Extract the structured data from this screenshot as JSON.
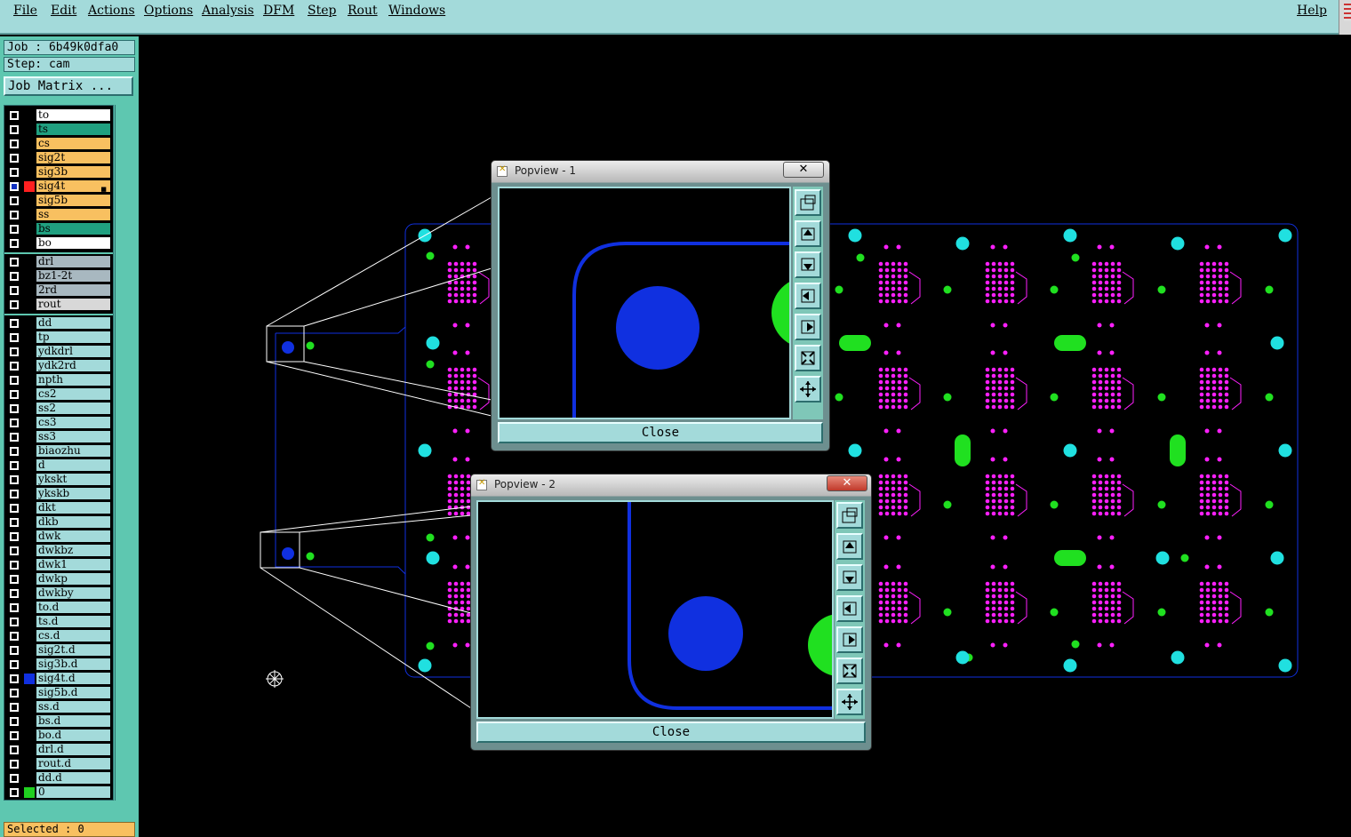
{
  "menu": {
    "file": "File",
    "edit": "Edit",
    "actions": "Actions",
    "options": "Options",
    "analysis": "Analysis",
    "dfm": "DFM",
    "step": "Step",
    "rout": "Rout",
    "windows": "Windows",
    "help": "Help"
  },
  "job": {
    "job_label": "Job : 6b49k0dfa0",
    "step_label": "Step: cam",
    "matrix_button": "Job Matrix ..."
  },
  "status": {
    "selected": "Selected : 0"
  },
  "layers": [
    {
      "name": "to",
      "bg": "#ffffff"
    },
    {
      "name": "ts",
      "bg": "#20a080"
    },
    {
      "name": "cs",
      "bg": "#f8c060"
    },
    {
      "name": "sig2t",
      "bg": "#f8c060"
    },
    {
      "name": "sig3b",
      "bg": "#f8c060"
    },
    {
      "name": "sig4t",
      "bg": "#f8c060",
      "selected": true,
      "color": "#ff2020"
    },
    {
      "name": "sig5b",
      "bg": "#f8c060"
    },
    {
      "name": "ss",
      "bg": "#f8c060"
    },
    {
      "name": "bs",
      "bg": "#20a080"
    },
    {
      "name": "bo",
      "bg": "#ffffff"
    },
    {
      "name": "drl",
      "bg": "#a8b8c0"
    },
    {
      "name": "bz1-2t",
      "bg": "#a8b8c0"
    },
    {
      "name": "2rd",
      "bg": "#a8b8c0"
    },
    {
      "name": "rout",
      "bg": "#d8d8d8"
    },
    {
      "name": "dd",
      "bg": "#a3dada"
    },
    {
      "name": "tp",
      "bg": "#a3dada"
    },
    {
      "name": "ydkdrl",
      "bg": "#a3dada"
    },
    {
      "name": "ydk2rd",
      "bg": "#a3dada"
    },
    {
      "name": "npth",
      "bg": "#a3dada"
    },
    {
      "name": "cs2",
      "bg": "#a3dada"
    },
    {
      "name": "ss2",
      "bg": "#a3dada"
    },
    {
      "name": "cs3",
      "bg": "#a3dada"
    },
    {
      "name": "ss3",
      "bg": "#a3dada"
    },
    {
      "name": "biaozhu",
      "bg": "#a3dada"
    },
    {
      "name": "d",
      "bg": "#a3dada"
    },
    {
      "name": "ykskt",
      "bg": "#a3dada"
    },
    {
      "name": "ykskb",
      "bg": "#a3dada"
    },
    {
      "name": "dkt",
      "bg": "#a3dada"
    },
    {
      "name": "dkb",
      "bg": "#a3dada"
    },
    {
      "name": "dwk",
      "bg": "#a3dada"
    },
    {
      "name": "dwkbz",
      "bg": "#a3dada"
    },
    {
      "name": "dwk1",
      "bg": "#a3dada"
    },
    {
      "name": "dwkp",
      "bg": "#a3dada"
    },
    {
      "name": "dwkby",
      "bg": "#a3dada"
    },
    {
      "name": "to.d",
      "bg": "#a3dada"
    },
    {
      "name": "ts.d",
      "bg": "#a3dada"
    },
    {
      "name": "cs.d",
      "bg": "#a3dada"
    },
    {
      "name": "sig2t.d",
      "bg": "#a3dada"
    },
    {
      "name": "sig3b.d",
      "bg": "#a3dada"
    },
    {
      "name": "sig4t.d",
      "bg": "#a3dada",
      "color": "#1030e0"
    },
    {
      "name": "sig5b.d",
      "bg": "#a3dada"
    },
    {
      "name": "ss.d",
      "bg": "#a3dada"
    },
    {
      "name": "bs.d",
      "bg": "#a3dada"
    },
    {
      "name": "bo.d",
      "bg": "#a3dada"
    },
    {
      "name": "drl.d",
      "bg": "#a3dada"
    },
    {
      "name": "rout.d",
      "bg": "#a3dada"
    },
    {
      "name": "dd.d",
      "bg": "#a3dada"
    },
    {
      "name": "0",
      "bg": "#a3dada",
      "color": "#20d020"
    }
  ],
  "popview1": {
    "title": "Popview - 1",
    "close_label": "Close"
  },
  "popview2": {
    "title": "Popview - 2",
    "close_label": "Close"
  },
  "colors": {
    "panel": "#5ec7b0",
    "menubar": "#a3dada",
    "trace": "#1030e0",
    "pad_magenta": "#ff20ff",
    "pad_green": "#20e020",
    "pad_cyan": "#20e0e0"
  }
}
